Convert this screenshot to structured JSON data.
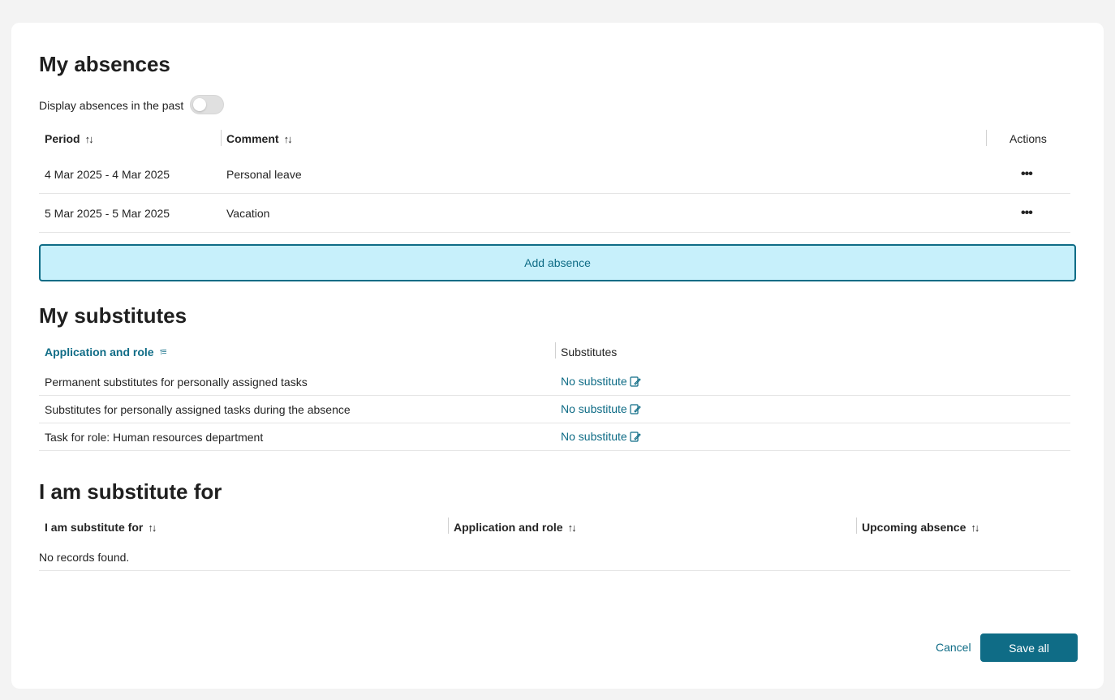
{
  "absences": {
    "title": "My absences",
    "toggle_label": "Display absences in the past",
    "toggle_on": false,
    "columns": {
      "period": "Period",
      "comment": "Comment",
      "actions": "Actions"
    },
    "rows": [
      {
        "period": "4 Mar 2025 - 4 Mar 2025",
        "comment": "Personal leave",
        "actions_icon": "more-horizontal-icon"
      },
      {
        "period": "5 Mar 2025 - 5 Mar 2025",
        "comment": "Vacation",
        "actions_icon": "more-horizontal-icon"
      }
    ],
    "add_label": "Add absence"
  },
  "substitutes": {
    "title": "My substitutes",
    "columns": {
      "app_role": "Application and role",
      "substitutes": "Substitutes"
    },
    "rows": [
      {
        "app_role": "Permanent substitutes for personally assigned tasks",
        "substitute": "No substitute"
      },
      {
        "app_role": "Substitutes for personally assigned tasks during the absence",
        "substitute": "No substitute"
      },
      {
        "app_role": "Task for role: Human resources department",
        "substitute": "No substitute"
      }
    ]
  },
  "substitute_for": {
    "title": "I am substitute for",
    "columns": {
      "person": "I am substitute for",
      "app_role": "Application and role",
      "upcoming": "Upcoming absence"
    },
    "empty": "No records found."
  },
  "footer": {
    "cancel": "Cancel",
    "save": "Save all"
  },
  "colors": {
    "accent": "#0f6c86",
    "add_bg": "#c7f0fb",
    "page_bg": "#f3f3f3"
  }
}
